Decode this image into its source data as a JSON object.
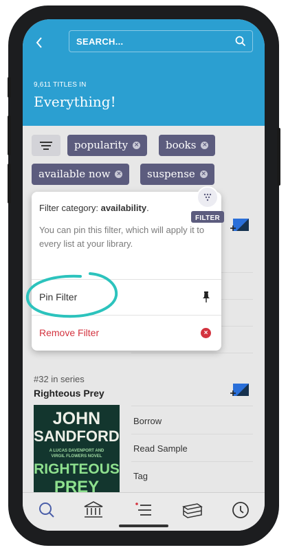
{
  "header": {
    "back_icon": "chevron-left-icon",
    "search_placeholder": "SEARCH...",
    "search_icon": "search-icon",
    "count_text": "9,611 TITLES IN",
    "collection_title": "Everything!"
  },
  "filters": {
    "button_icon": "filter-lines-icon",
    "chips": [
      {
        "label": "popularity"
      },
      {
        "label": "books"
      },
      {
        "label": "available now"
      },
      {
        "label": "suspense"
      }
    ]
  },
  "popover": {
    "category_prefix": "Filter category: ",
    "category_name": "availability",
    "category_suffix": ".",
    "description": "You can pin this filter, which will apply it to every list at your library.",
    "pin_label": "Pin Filter",
    "pin_icon": "pushpin-icon",
    "remove_label": "Remove Filter",
    "remove_icon": "close-circle-icon",
    "badge_label": "FILTER",
    "badge_icon": "funnel-icon"
  },
  "book": {
    "series_meta": "#32 in series",
    "title": "Righteous Prey",
    "cover": {
      "author_line_1": "JOHN",
      "author_line_2": "SANDFORD",
      "tagline_1": "A LUCAS DAVENPORT AND",
      "tagline_2": "VIRGIL FLOWERS NOVEL",
      "title_line_1": "RIGHTEOUS",
      "title_line_2": "PREY"
    },
    "actions": [
      "Borrow",
      "Read Sample",
      "Tag"
    ]
  },
  "nav": {
    "items": [
      {
        "icon": "search-icon"
      },
      {
        "icon": "library-icon"
      },
      {
        "icon": "menu-list-icon"
      },
      {
        "icon": "books-shelf-icon"
      },
      {
        "icon": "clock-icon"
      }
    ]
  },
  "colors": {
    "header_blue": "#2b9fd1",
    "chip": "#5c5c7e",
    "teal_highlight": "#2cc3bd",
    "remove_red": "#d3333f",
    "accent_blue": "#2a6fd9"
  }
}
